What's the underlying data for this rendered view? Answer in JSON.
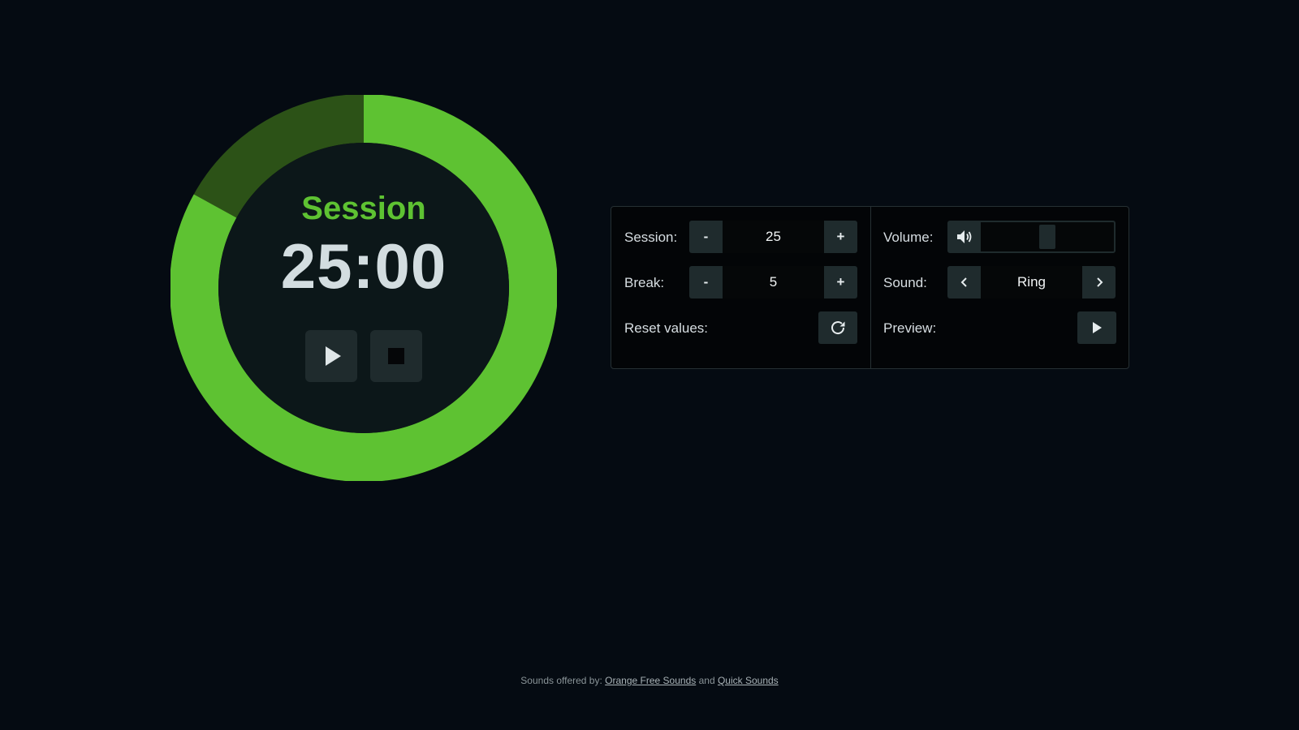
{
  "colors": {
    "background": "#050b12",
    "accent": "#5ec232",
    "accent_dim": "#2c5217",
    "dial_face": "#0c1719",
    "button": "#1f2b2d"
  },
  "timer": {
    "phase": "Session",
    "time": "25:00",
    "remaining_fraction": 0.83,
    "play_icon": "play-icon",
    "stop_icon": "stop-icon"
  },
  "settings": {
    "session": {
      "label": "Session:",
      "value": "25",
      "decrement": "-",
      "increment": "+"
    },
    "break": {
      "label": "Break:",
      "value": "5",
      "decrement": "-",
      "increment": "+"
    },
    "reset": {
      "label": "Reset values:",
      "icon": "reset-icon"
    },
    "volume": {
      "label": "Volume:",
      "icon": "volume-icon",
      "level": 0.5
    },
    "sound": {
      "label": "Sound:",
      "value": "Ring",
      "prev_icon": "chevron-left-icon",
      "next_icon": "chevron-right-icon"
    },
    "preview": {
      "label": "Preview:",
      "icon": "play-icon"
    }
  },
  "footer": {
    "prefix": "Sounds offered by:",
    "link1": "Orange Free Sounds",
    "conjunction": "and",
    "link2": "Quick Sounds"
  }
}
